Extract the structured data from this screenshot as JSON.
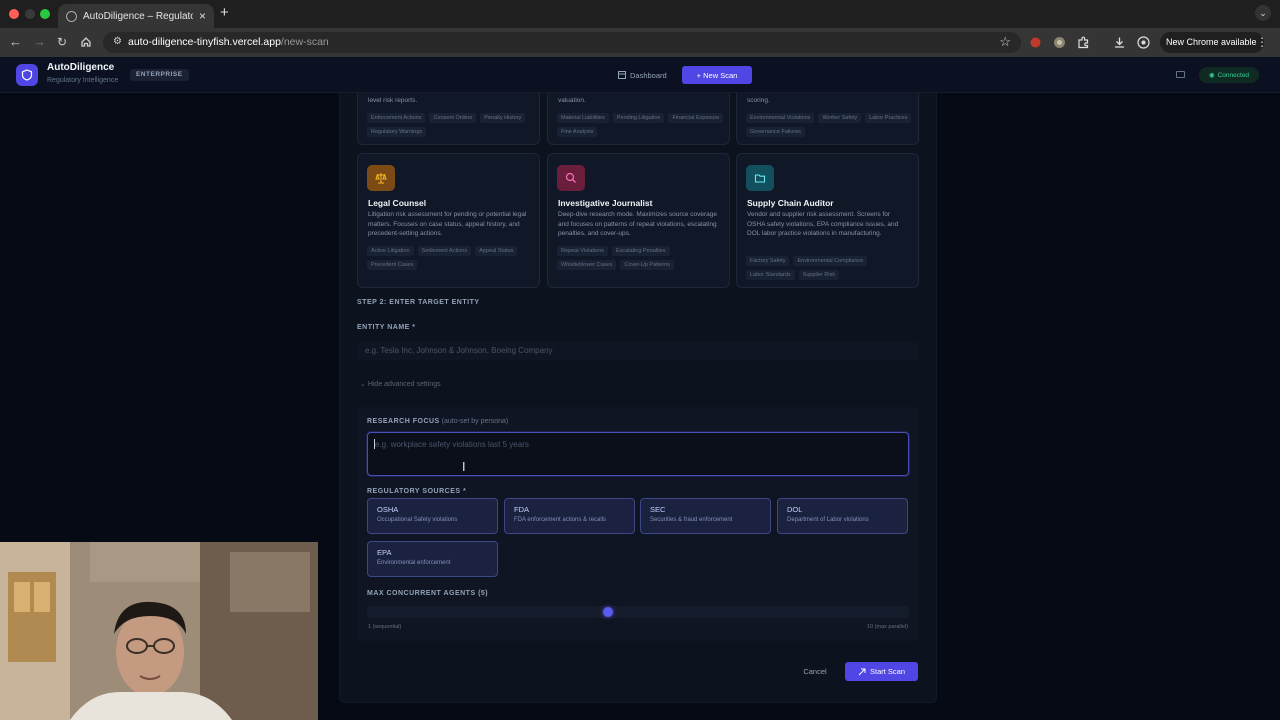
{
  "browser": {
    "tab_title": "AutoDiligence – Regulatory R",
    "new_tab": "+",
    "url_host": "auto-diligence-tinyfish.vercel.app",
    "url_path": "/new-scan",
    "new_chrome_label": "New Chrome available"
  },
  "header": {
    "brand": "AutoDiligence",
    "subtitle": "Regulatory Intelligence",
    "badge": "ENTERPRISE",
    "nav_dashboard": "Dashboard",
    "nav_new_scan": "+ New Scan",
    "status": "Connected"
  },
  "personas_top": [
    {
      "desc": "level risk reports.",
      "tags": [
        "Enforcement Actions",
        "Consent Orders",
        "Penalty History",
        "Regulatory Warnings"
      ]
    },
    {
      "desc": "valuation.",
      "tags": [
        "Material Liabilities",
        "Pending Litigation",
        "Financial Exposure",
        "Fine Analysis"
      ]
    },
    {
      "desc": "scoring.",
      "tags": [
        "Environmental Violations",
        "Worker Safety",
        "Labor Practices",
        "Governance Failures"
      ]
    }
  ],
  "personas": [
    {
      "title": "Legal Counsel",
      "icon": "scales-icon",
      "color": "#b45309",
      "desc": "Litigation risk assessment for pending or potential legal matters. Focuses on case status, appeal history, and precedent-setting actions.",
      "tags": [
        "Active Litigation",
        "Settlement Actions",
        "Appeal Status",
        "Precedent Cases"
      ]
    },
    {
      "title": "Investigative Journalist",
      "icon": "search-icon",
      "color": "#be185d",
      "desc": "Deep-dive research mode. Maximizes source coverage and focuses on patterns of repeat violations, escalating penalties, and cover-ups.",
      "tags": [
        "Repeat Violations",
        "Escalating Penalties",
        "Whistleblower Cases",
        "Cover-Up Patterns"
      ]
    },
    {
      "title": "Supply Chain Auditor",
      "icon": "folder-icon",
      "color": "#0e7490",
      "desc": "Vendor and supplier risk assessment. Screens for OSHA safety violations, EPA compliance issues, and DOL labor practice violations in manufacturing.",
      "tags": [
        "Factory Safety",
        "Environmental Compliance",
        "Labor Standards",
        "Supplier Risk"
      ]
    }
  ],
  "form": {
    "step2_title": "STEP 2: ENTER TARGET ENTITY",
    "entity_label": "ENTITY NAME *",
    "entity_placeholder": "e.g. Tesla Inc, Johnson & Johnson, Boeing Company",
    "advanced_toggle": "Hide advanced settings",
    "focus_label": "RESEARCH FOCUS",
    "focus_note": " (auto-set by persona)",
    "focus_placeholder": "e.g. workplace safety violations last 5 years",
    "sources_label": "REGULATORY SOURCES *",
    "sources": [
      {
        "name": "OSHA",
        "desc": "Occupational Safety violations"
      },
      {
        "name": "FDA",
        "desc": "FDA enforcement actions & recalls"
      },
      {
        "name": "SEC",
        "desc": "Securities & fraud enforcement"
      },
      {
        "name": "DOL",
        "desc": "Department of Labor violations"
      },
      {
        "name": "EPA",
        "desc": "Environmental enforcement"
      }
    ],
    "agents_label": "MAX CONCURRENT AGENTS (5)",
    "agents_value": 5,
    "agents_min": 1,
    "agents_max": 10,
    "agents_min_label": "1 (sequential)",
    "agents_max_label": "10 (max parallel)",
    "cancel_label": "Cancel",
    "start_label": "Start Scan"
  },
  "colors": {
    "accent": "#5046e5",
    "connected": "#34d399"
  }
}
